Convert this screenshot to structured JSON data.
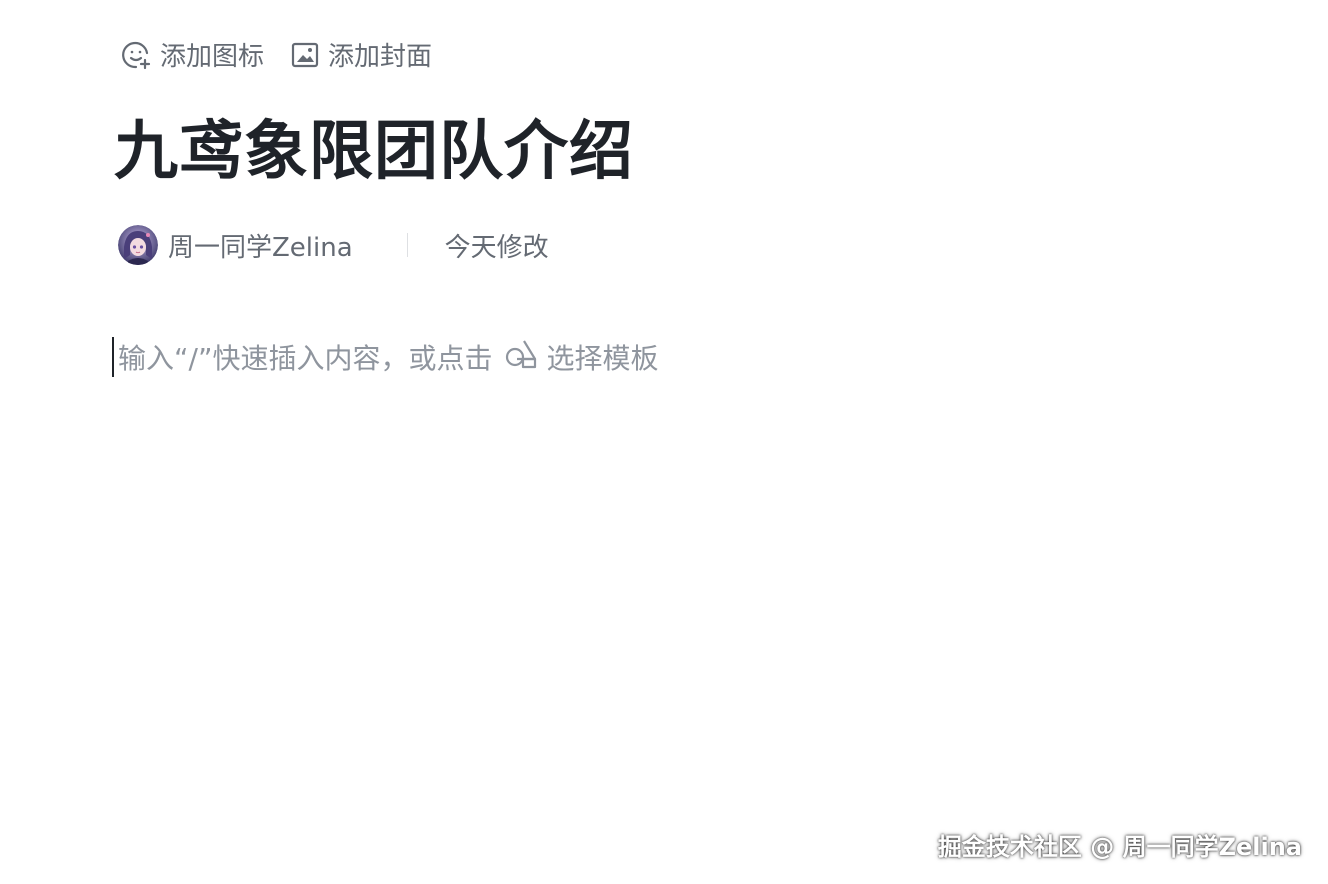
{
  "header": {
    "add_icon_label": "添加图标",
    "add_cover_label": "添加封面"
  },
  "document": {
    "title": "九鸢象限团队介绍",
    "author": "周一同学Zelina",
    "modified": "今天修改"
  },
  "editor": {
    "placeholder": "输入“/”快速插入内容，或点击",
    "template_label": "选择模板"
  },
  "watermark": "掘金技术社区 @ 周一同学Zelina",
  "icons": {
    "add_icon": "smiley-plus-icon",
    "add_cover": "image-icon",
    "template": "template-shapes-icon"
  },
  "colors": {
    "title": "#1f2329",
    "secondary_text": "#646a73",
    "placeholder": "#8f959e"
  }
}
